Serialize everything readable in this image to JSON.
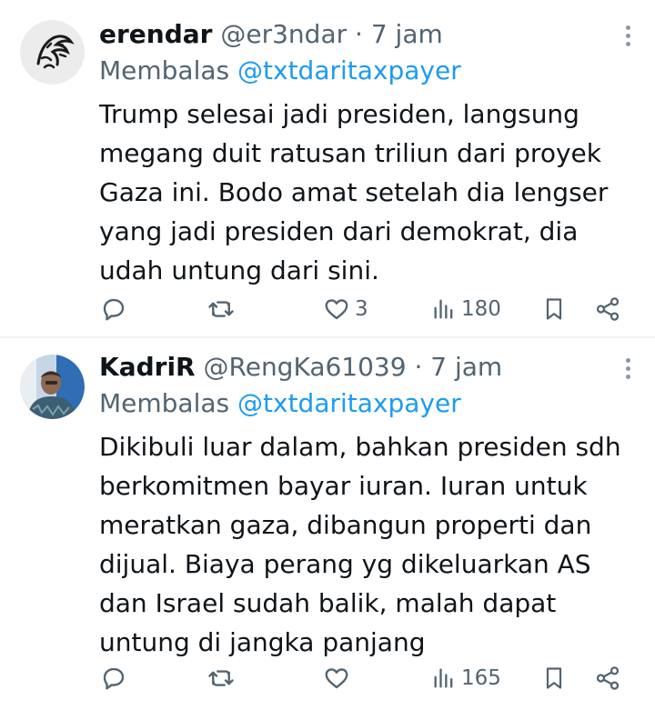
{
  "tweets": [
    {
      "display_name": "erendar",
      "handle": "@er3ndar",
      "separator": "·",
      "time": "7 jam",
      "reply_prefix": "Membalas",
      "reply_handle": "@txtdaritaxpayer",
      "lines": [
        "Trump selesai jadi presiden, langsung",
        "megang duit ratusan triliun dari proyek",
        "Gaza ini. Bodo amat setelah dia lengser",
        "yang jadi presiden dari demokrat, dia",
        "udah untung dari sini."
      ],
      "likes": "3",
      "views": "180",
      "avatar_icon": "eagle-sketch-icon"
    },
    {
      "display_name": "KadriR",
      "handle": "@RengKa61039",
      "separator": "·",
      "time": "7 jam",
      "reply_prefix": "Membalas",
      "reply_handle": "@txtdaritaxpayer",
      "lines": [
        "Dikibuli luar dalam, bahkan presiden sdh",
        "berkomitmen bayar iuran. Iuran untuk",
        "meratkan gaza, dibangun properti dan",
        "dijual. Biaya perang yg dikeluarkan AS",
        "dan Israel sudah balik, malah dapat",
        "untung di jangka panjang"
      ],
      "likes": "",
      "views": "165",
      "avatar_icon": "person-photo-icon"
    }
  ],
  "icons": {
    "reply": "reply-icon",
    "retweet": "retweet-icon",
    "like": "heart-icon",
    "views": "views-icon",
    "bookmark": "bookmark-icon",
    "share": "share-icon",
    "more": "more-vertical-icon"
  },
  "colors": {
    "text": "#0f1419",
    "secondary": "#536471",
    "link": "#1d9bf0",
    "divider": "#eff3f4"
  }
}
